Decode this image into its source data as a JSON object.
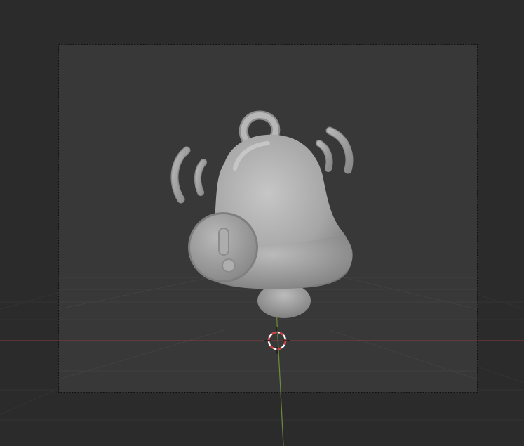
{
  "viewport": {
    "background_color": "#2b2b2b",
    "camera_frame_color": "#383838",
    "x_axis_color": "#8f3a3a",
    "y_axis_color": "#6f8b3a"
  },
  "model": {
    "name": "bell-with-exclamation-badge",
    "body_color": "#9c9c9c",
    "badge_symbol": "!"
  },
  "icons": {
    "cursor": "3d-cursor-icon",
    "bell": "bell-icon",
    "alert": "exclamation-icon",
    "sound_waves": "sound-wave-icon"
  }
}
